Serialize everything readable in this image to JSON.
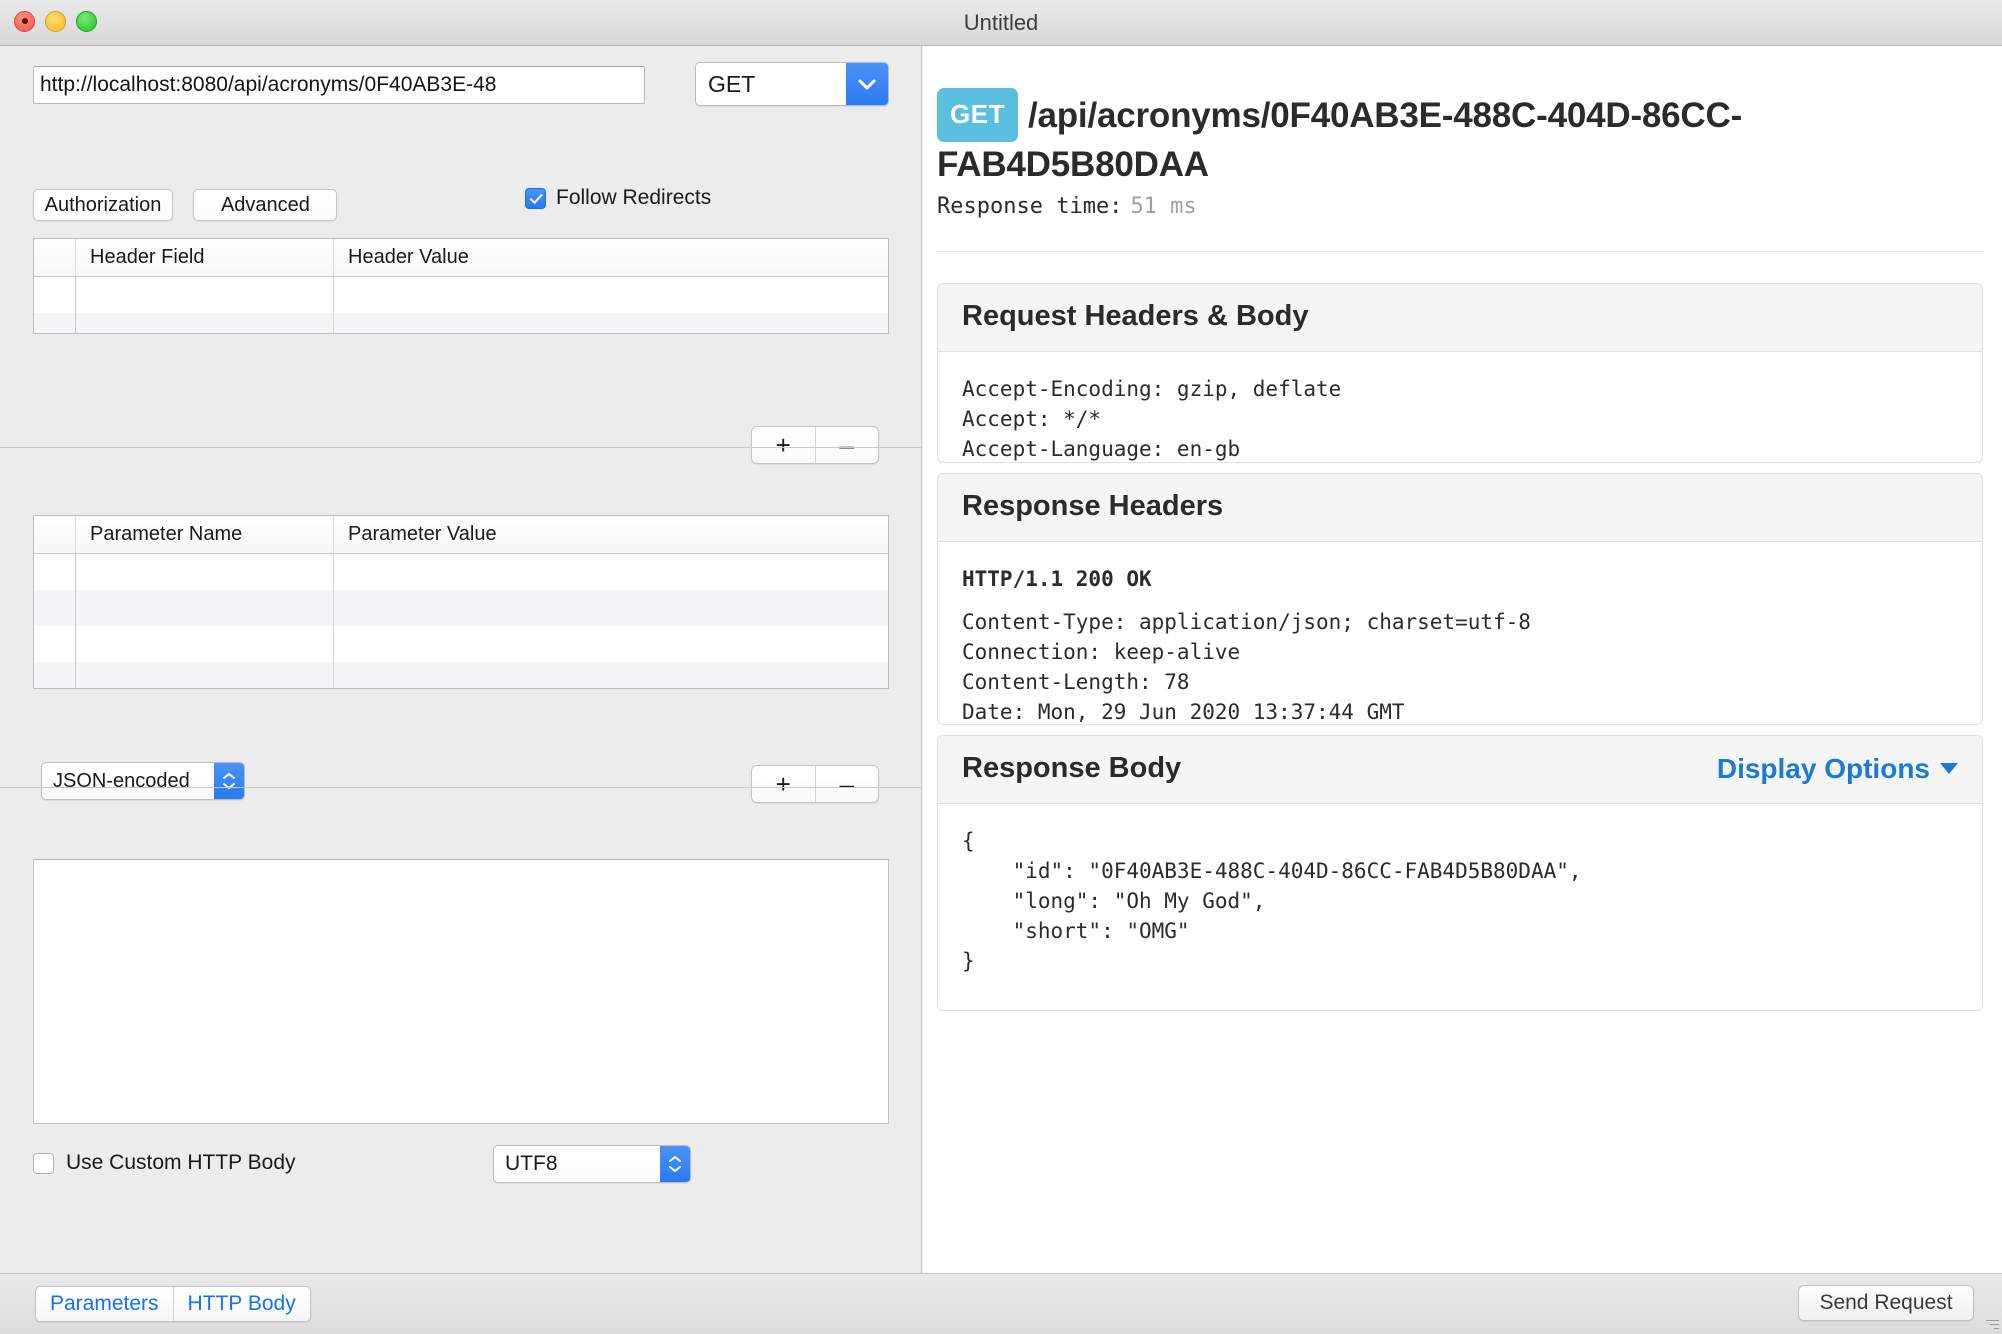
{
  "window": {
    "title": "Untitled",
    "traffic_lights": [
      "close",
      "minimize",
      "zoom"
    ]
  },
  "request_builder": {
    "url_value": "http://localhost:8080/api/acronyms/0F40AB3E-48",
    "url_placeholder": "",
    "method_selected": "GET",
    "authorization_label": "Authorization",
    "advanced_label": "Advanced",
    "follow_redirects_label": "Follow Redirects",
    "follow_redirects_checked": true,
    "headers_table": {
      "columns": [
        "",
        "Header Field",
        "Header Value"
      ],
      "rows": [
        [
          "",
          "",
          ""
        ],
        [
          "",
          "",
          ""
        ],
        [
          "",
          "",
          ""
        ]
      ]
    },
    "headers_add_label": "+",
    "headers_remove_label": "–",
    "params_table": {
      "columns": [
        "",
        "Parameter Name",
        "Parameter Value"
      ],
      "rows": [
        [
          "",
          "",
          ""
        ],
        [
          "",
          "",
          ""
        ],
        [
          "",
          "",
          ""
        ],
        [
          "",
          "",
          ""
        ],
        [
          "",
          "",
          ""
        ]
      ]
    },
    "params_add_label": "+",
    "params_remove_label": "–",
    "encoding_selected": "JSON-encoded",
    "http_body_value": "",
    "use_custom_body_label": "Use Custom HTTP Body",
    "use_custom_body_checked": false,
    "charset_selected": "UTF8"
  },
  "bottom_bar": {
    "tabs": [
      {
        "label": "Parameters",
        "selected": true
      },
      {
        "label": "HTTP Body",
        "selected": false
      }
    ],
    "send_label": "Send Request"
  },
  "response": {
    "method_badge": "GET",
    "endpoint_path": "/api/acronyms/0F40AB3E-488C-404D-86CC-FAB4D5B80DAA",
    "response_time_label": "Response time:",
    "response_time_value": "51 ms",
    "request_card": {
      "title": "Request Headers & Body",
      "lines": [
        "Accept-Encoding: gzip, deflate",
        "Accept: */*",
        "Accept-Language: en-gb"
      ]
    },
    "response_headers_card": {
      "title": "Response Headers",
      "status_line": "HTTP/1.1 200 OK",
      "lines": [
        "Content-Type: application/json; charset=utf-8",
        "Connection: keep-alive",
        "Content-Length: 78",
        "Date: Mon, 29 Jun 2020 13:37:44 GMT"
      ]
    },
    "response_body_card": {
      "title": "Response Body",
      "display_options_label": "Display Options",
      "body": "{\n    \"id\": \"0F40AB3E-488C-404D-86CC-FAB4D5B80DAA\",\n    \"long\": \"Oh My God\",\n    \"short\": \"OMG\"\n}"
    }
  },
  "colors": {
    "accent_blue": "#1273f0",
    "badge_blue": "#5bc0de",
    "link_blue": "#1a7bd4",
    "window_chrome": "#ececec"
  }
}
